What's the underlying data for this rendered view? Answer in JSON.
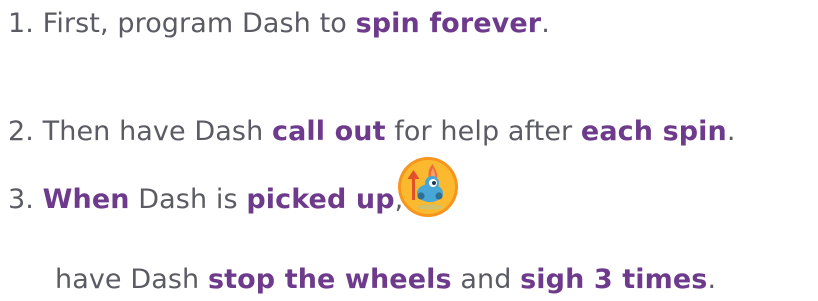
{
  "steps": [
    {
      "number": "1.",
      "parts": [
        "First, program Dash to ",
        "spin forever",
        "."
      ]
    },
    {
      "number": "2.",
      "parts": [
        "Then have Dash ",
        "call out",
        " for help after ",
        "each spin",
        "."
      ]
    },
    {
      "number": "3.",
      "parts": [
        "When",
        " Dash is ",
        "picked up",
        ","
      ],
      "continuation": [
        "have Dash ",
        "stop the wheels",
        " and ",
        "sigh 3 times",
        "."
      ]
    }
  ],
  "icons": {
    "picked_up_event": "dash-picked-up-icon"
  },
  "colors": {
    "text": "#5b5b64",
    "highlight": "#6e3b8c",
    "icon_bg": "#fbb92f",
    "icon_ring": "#f7951d",
    "dash_body": "#48a7d6",
    "arrow": "#e2502a"
  }
}
